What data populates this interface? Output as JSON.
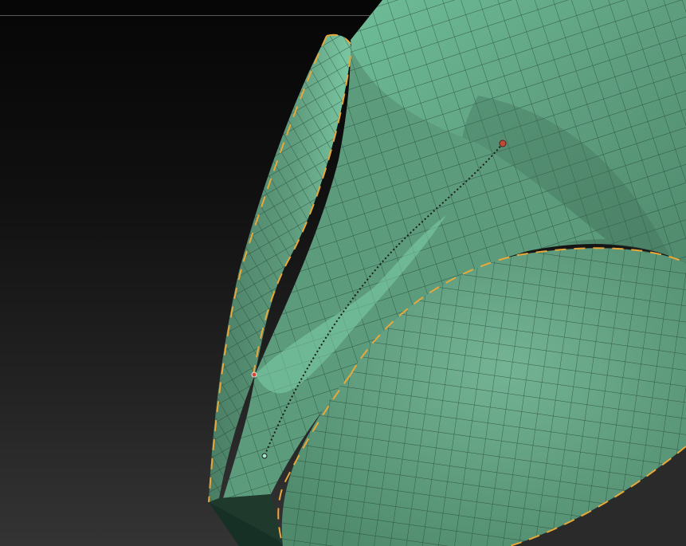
{
  "viewport": {
    "background_top": "#060606",
    "background_bottom": "#343434",
    "top_divider_color": "#5a5a5a"
  },
  "mesh": {
    "name": "polygroup-mesh",
    "base_color": "#5e9e7f",
    "highlight_color": "#73c4a0",
    "shadow_color": "#2f5a46",
    "wire_color": "#1f3d30",
    "crease_color": "#e8a83a"
  },
  "stroke": {
    "start_marker_color": "#c04a3a",
    "end_marker_color": "#9fe8c8",
    "path_color": "#1a1a1a"
  }
}
